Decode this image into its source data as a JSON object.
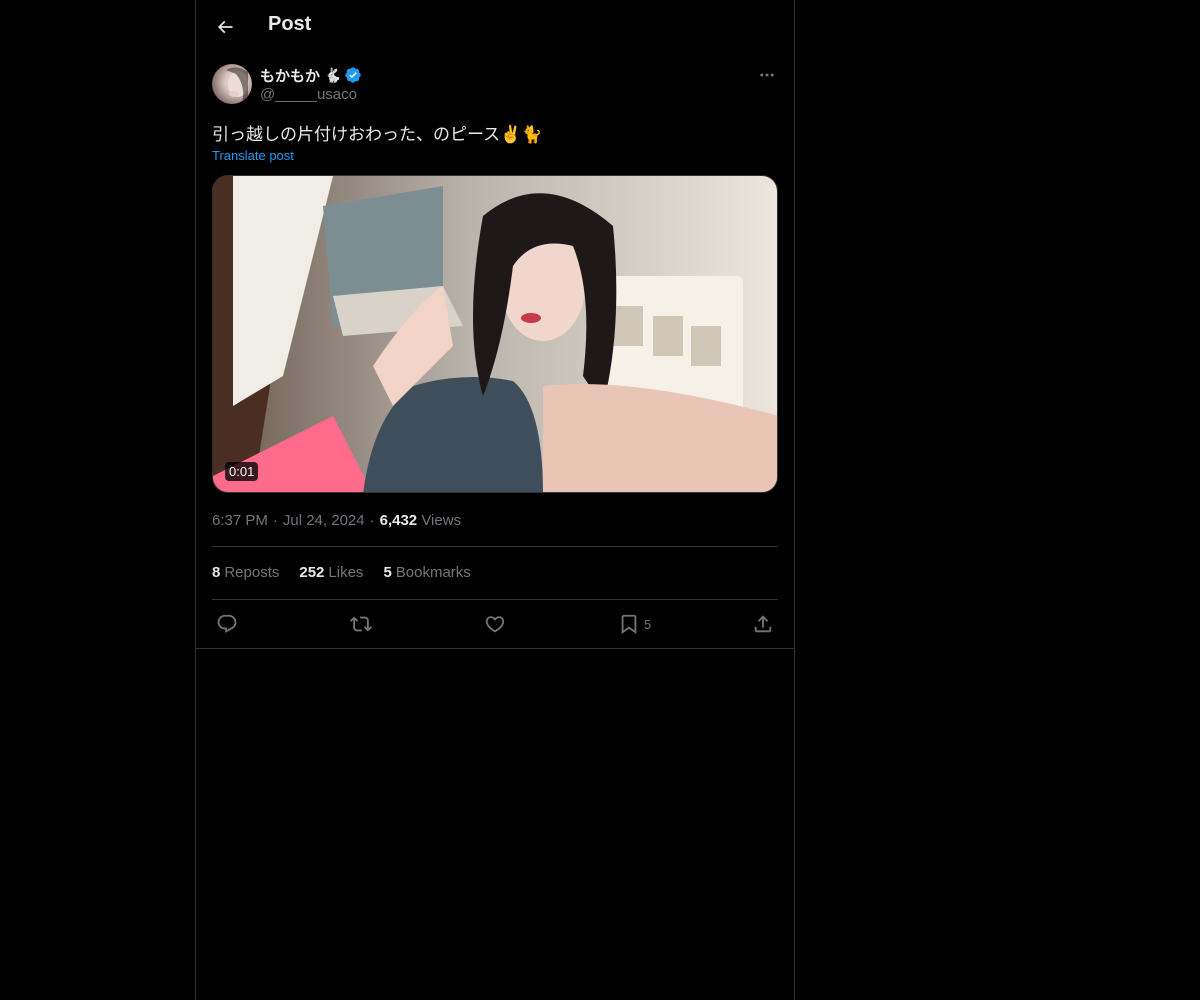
{
  "header": {
    "title": "Post",
    "back_icon": "arrow-left-icon"
  },
  "author": {
    "display_name": "もかもか",
    "name_emoji": "🐇",
    "verified": true,
    "handle": "@_____usaco"
  },
  "tweet": {
    "text": "引っ越しの片付けおわった、のピース✌️🐈",
    "translate_label": "Translate post"
  },
  "media": {
    "type": "video",
    "duration": "0:01"
  },
  "meta": {
    "time": "6:37 PM",
    "separator": "·",
    "date": "Jul 24, 2024",
    "views_count": "6,432",
    "views_label": "Views"
  },
  "stats": {
    "reposts_count": "8",
    "reposts_label": "Reposts",
    "likes_count": "252",
    "likes_label": "Likes",
    "bookmarks_count": "5",
    "bookmarks_label": "Bookmarks"
  },
  "actions": {
    "bookmark_count": "5"
  },
  "colors": {
    "background": "#000000",
    "text": "#e7e9ea",
    "secondary_text": "#71767b",
    "accent": "#1d9bf0",
    "border": "#2f3336"
  }
}
